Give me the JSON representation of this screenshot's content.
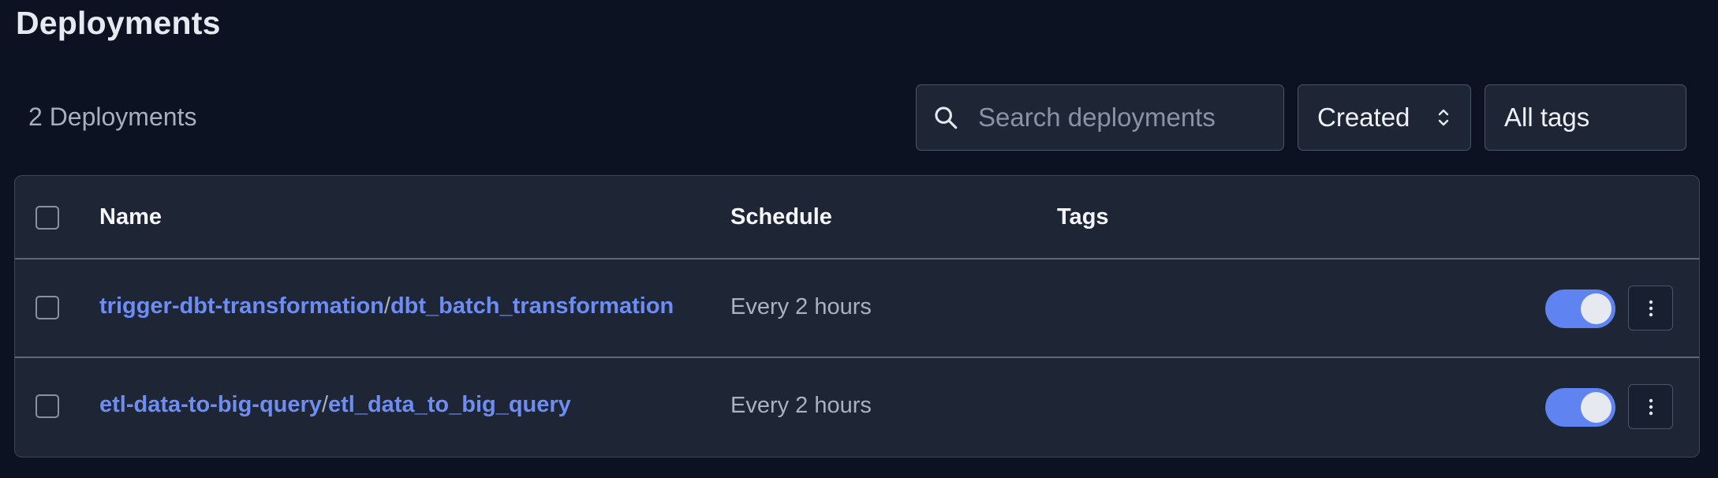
{
  "page": {
    "title": "Deployments",
    "count_label": "2 Deployments"
  },
  "search": {
    "placeholder": "Search deployments",
    "value": "",
    "icon": "search-icon"
  },
  "sort": {
    "selected": "Created",
    "icon": "chevron-up-down-icon"
  },
  "tags_filter": {
    "selected": "All tags"
  },
  "table": {
    "columns": {
      "name": "Name",
      "schedule": "Schedule",
      "tags": "Tags"
    },
    "rows": [
      {
        "flow": "trigger-dbt-transformation",
        "separator": "/",
        "deployment": "dbt_batch_transformation",
        "schedule": "Every 2 hours",
        "tags": [],
        "active": true
      },
      {
        "flow": "etl-data-to-big-query",
        "separator": "/",
        "deployment": "etl_data_to_big_query",
        "schedule": "Every 2 hours",
        "tags": [],
        "active": true
      }
    ]
  },
  "colors": {
    "background": "#0c1222",
    "panel": "#1e2636",
    "link": "#6d8df2",
    "toggle_on": "#5f83f0",
    "border": "#4a5567"
  }
}
